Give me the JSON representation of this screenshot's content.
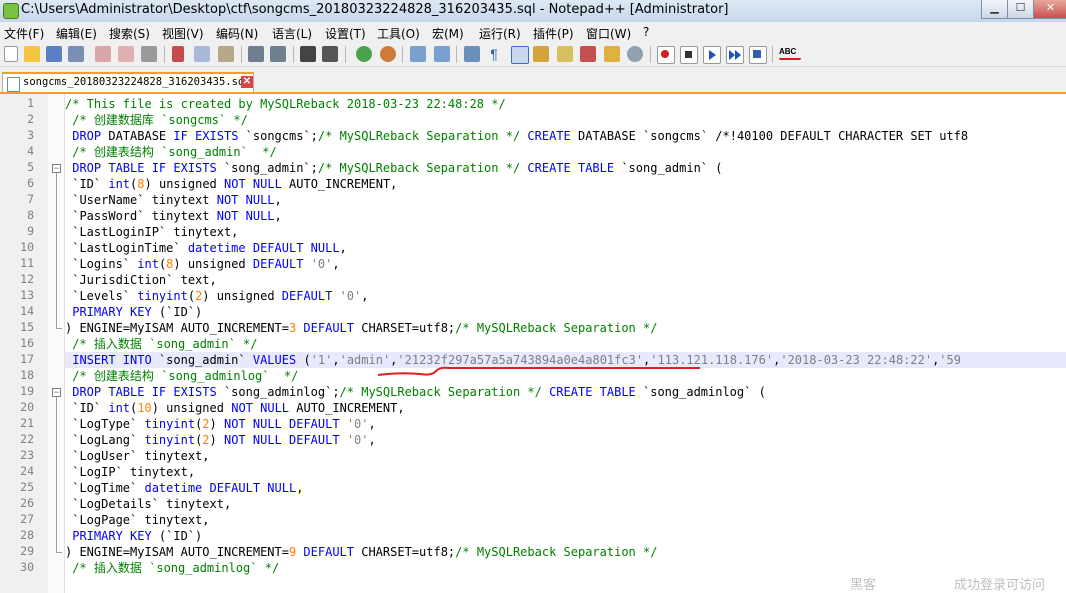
{
  "window": {
    "title": "C:\\Users\\Administrator\\Desktop\\ctf\\songcms_20180323224828_316203435.sql - Notepad++ [Administrator]"
  },
  "menu": [
    "文件(F)",
    "编辑(E)",
    "搜索(S)",
    "视图(V)",
    "编码(N)",
    "语言(L)",
    "设置(T)",
    "工具(O)",
    "宏(M)",
    "运行(R)",
    "插件(P)",
    "窗口(W)",
    "?"
  ],
  "tab": {
    "label": "songcms_20180323224828_316203435.sql",
    "close": "✕"
  },
  "line_numbers": [
    "1",
    "2",
    "3",
    "4",
    "5",
    "6",
    "7",
    "8",
    "9",
    "10",
    "11",
    "12",
    "13",
    "14",
    "15",
    "16",
    "17",
    "18",
    "19",
    "20",
    "21",
    "22",
    "23",
    "24",
    "25",
    "26",
    "27",
    "28",
    "29",
    "30"
  ],
  "code_lines": [
    [
      [
        "cm",
        "/* This file is created by MySQLReback 2018-03-23 22:48:28 */"
      ]
    ],
    [
      [
        "cm",
        " /* 创建数据库 `songcms` */"
      ]
    ],
    [
      [
        "kw",
        " DROP "
      ],
      [
        "",
        "DATABASE "
      ],
      [
        "kw",
        "IF EXISTS"
      ],
      [
        "",
        " `songcms`;"
      ],
      [
        "cm",
        "/* MySQLReback Separation */"
      ],
      [
        "kw",
        " CREATE "
      ],
      [
        "",
        "DATABASE `songcms` /*!40100 DEFAULT CHARACTER SET utf8"
      ]
    ],
    [
      [
        "cm",
        " /* 创建表结构 `song_admin`  */"
      ]
    ],
    [
      [
        "kw",
        " DROP TABLE IF EXISTS"
      ],
      [
        "",
        " `song_admin`;"
      ],
      [
        "cm",
        "/* MySQLReback Separation */"
      ],
      [
        "kw",
        " CREATE TABLE"
      ],
      [
        "",
        " `song_admin` ("
      ]
    ],
    [
      [
        "",
        " `ID` "
      ],
      [
        "kw",
        "int"
      ],
      [
        "",
        "("
      ],
      [
        "num",
        "8"
      ],
      [
        "",
        ") unsigned "
      ],
      [
        "kw",
        "NOT NULL"
      ],
      [
        "",
        " AUTO_INCREMENT,"
      ]
    ],
    [
      [
        "",
        " `UserName` tinytext "
      ],
      [
        "kw",
        "NOT NULL"
      ],
      [
        "",
        ","
      ]
    ],
    [
      [
        "",
        " `PassWord` tinytext "
      ],
      [
        "kw",
        "NOT NULL"
      ],
      [
        "",
        ","
      ]
    ],
    [
      [
        "",
        " `LastLoginIP` tinytext,"
      ]
    ],
    [
      [
        "",
        " `LastLoginTime` "
      ],
      [
        "kw",
        "datetime DEFAULT NULL"
      ],
      [
        "",
        ","
      ]
    ],
    [
      [
        "",
        " `Logins` "
      ],
      [
        "kw",
        "int"
      ],
      [
        "",
        "("
      ],
      [
        "num",
        "8"
      ],
      [
        "",
        ") unsigned "
      ],
      [
        "kw",
        "DEFAULT "
      ],
      [
        "str",
        "'0'"
      ],
      [
        "",
        ","
      ]
    ],
    [
      [
        "",
        " `JurisdiCtion` text,"
      ]
    ],
    [
      [
        "",
        " `Levels` "
      ],
      [
        "kw",
        "tinyint"
      ],
      [
        "",
        "("
      ],
      [
        "num",
        "2"
      ],
      [
        "",
        ") unsigned "
      ],
      [
        "kw",
        "DEFAULT "
      ],
      [
        "str",
        "'0'"
      ],
      [
        "",
        ","
      ]
    ],
    [
      [
        "kw",
        " PRIMARY KEY"
      ],
      [
        "",
        " (`ID`)"
      ]
    ],
    [
      [
        "",
        ") ENGINE=MyISAM AUTO_INCREMENT="
      ],
      [
        "num",
        "3"
      ],
      [
        "kw",
        " DEFAULT"
      ],
      [
        "",
        " CHARSET=utf8;"
      ],
      [
        "cm",
        "/* MySQLReback Separation */"
      ]
    ],
    [
      [
        "cm",
        " /* 插入数据 `song_admin` */"
      ]
    ],
    [
      [
        "kw",
        " INSERT INTO"
      ],
      [
        "",
        " `song_admin` "
      ],
      [
        "kw",
        "VALUES"
      ],
      [
        "",
        " ("
      ],
      [
        "str",
        "'1'"
      ],
      [
        "",
        ","
      ],
      [
        "str",
        "'admin'"
      ],
      [
        "",
        ","
      ],
      [
        "str",
        "'21232f297a57a5a743894a0e4a801fc3'"
      ],
      [
        "",
        ","
      ],
      [
        "str",
        "'113.121.118.176'"
      ],
      [
        "",
        ","
      ],
      [
        "str",
        "'2018-03-23 22:48:22'"
      ],
      [
        "",
        ","
      ],
      [
        "str",
        "'59"
      ]
    ],
    [
      [
        "cm",
        " /* 创建表结构 `song_adminlog`  */"
      ]
    ],
    [
      [
        "kw",
        " DROP TABLE IF EXISTS"
      ],
      [
        "",
        " `song_adminlog`;"
      ],
      [
        "cm",
        "/* MySQLReback Separation */"
      ],
      [
        "kw",
        " CREATE TABLE"
      ],
      [
        "",
        " `song_adminlog` ("
      ]
    ],
    [
      [
        "",
        " `ID` "
      ],
      [
        "kw",
        "int"
      ],
      [
        "",
        "("
      ],
      [
        "num",
        "10"
      ],
      [
        "",
        ") unsigned "
      ],
      [
        "kw",
        "NOT NULL"
      ],
      [
        "",
        " AUTO_INCREMENT,"
      ]
    ],
    [
      [
        "",
        " `LogType` "
      ],
      [
        "kw",
        "tinyint"
      ],
      [
        "",
        "("
      ],
      [
        "num",
        "2"
      ],
      [
        "",
        ") "
      ],
      [
        "kw",
        "NOT NULL DEFAULT "
      ],
      [
        "str",
        "'0'"
      ],
      [
        "",
        ","
      ]
    ],
    [
      [
        "",
        " `LogLang` "
      ],
      [
        "kw",
        "tinyint"
      ],
      [
        "",
        "("
      ],
      [
        "num",
        "2"
      ],
      [
        "",
        ") "
      ],
      [
        "kw",
        "NOT NULL DEFAULT "
      ],
      [
        "str",
        "'0'"
      ],
      [
        "",
        ","
      ]
    ],
    [
      [
        "",
        " `LogUser` tinytext,"
      ]
    ],
    [
      [
        "",
        " `LogIP` tinytext,"
      ]
    ],
    [
      [
        "",
        " `LogTime` "
      ],
      [
        "kw",
        "datetime DEFAULT NULL"
      ],
      [
        "",
        ","
      ]
    ],
    [
      [
        "",
        " `LogDetails` tinytext,"
      ]
    ],
    [
      [
        "",
        " `LogPage` tinytext,"
      ]
    ],
    [
      [
        "kw",
        " PRIMARY KEY"
      ],
      [
        "",
        " (`ID`)"
      ]
    ],
    [
      [
        "",
        ") ENGINE=MyISAM AUTO_INCREMENT="
      ],
      [
        "num",
        "9"
      ],
      [
        "kw",
        " DEFAULT"
      ],
      [
        "",
        " CHARSET=utf8;"
      ],
      [
        "cm",
        "/* MySQLReback Separation */"
      ]
    ],
    [
      [
        "cm",
        " /* 插入数据 `song_adminlog` */"
      ]
    ]
  ],
  "current_line": 17,
  "watermark": "黑客　　　　　　成功登录可访问"
}
